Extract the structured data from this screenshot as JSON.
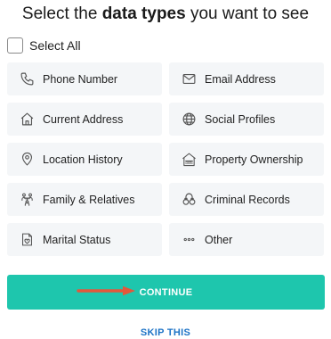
{
  "header": {
    "title_prefix": "Select the ",
    "title_bold": "data types",
    "title_suffix": " you want to see"
  },
  "select_all": {
    "label": "Select All",
    "checked": false
  },
  "options": [
    {
      "label": "Phone Number",
      "icon": "phone-icon"
    },
    {
      "label": "Email Address",
      "icon": "envelope-icon"
    },
    {
      "label": "Current Address",
      "icon": "house-icon"
    },
    {
      "label": "Social Profiles",
      "icon": "globe-icon"
    },
    {
      "label": "Location History",
      "icon": "location-pin-icon"
    },
    {
      "label": "Property Ownership",
      "icon": "sold-house-icon"
    },
    {
      "label": "Family & Relatives",
      "icon": "family-tree-icon"
    },
    {
      "label": "Criminal Records",
      "icon": "handcuffs-icon"
    },
    {
      "label": "Marital Status",
      "icon": "marriage-certificate-icon"
    },
    {
      "label": "Other",
      "icon": "ellipsis-icon"
    }
  ],
  "actions": {
    "continue_label": "CONTINUE",
    "skip_label": "SKIP THIS"
  },
  "colors": {
    "accent": "#1ec6ad",
    "link": "#1d73c6",
    "tile_bg": "#f4f6f8",
    "arrow": "#e4573b"
  }
}
